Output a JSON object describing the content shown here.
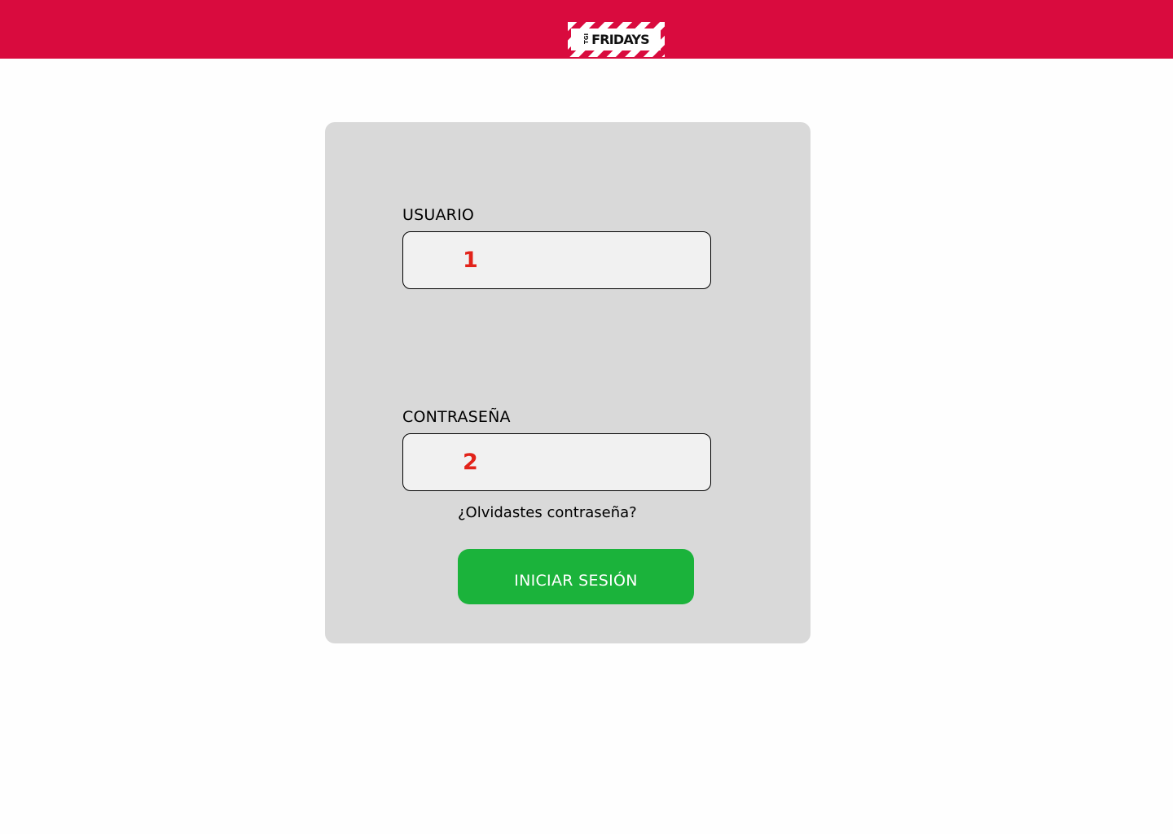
{
  "header": {
    "logo": {
      "prefix": "TGI",
      "word": "FRIDAYS",
      "stripe_color": "#d90b3e",
      "badge_color": "#ffffff"
    },
    "bar_color": "#d90b3e"
  },
  "login": {
    "username_label": "USUARIO",
    "username_value": "1",
    "password_label": "CONTRASEÑA",
    "password_value": "2",
    "forgot_link": "¿Olvidastes contraseña?",
    "submit_label": "INICIAR SESIÓN",
    "submit_color": "#1bb33b",
    "value_color": "#e2231a"
  }
}
